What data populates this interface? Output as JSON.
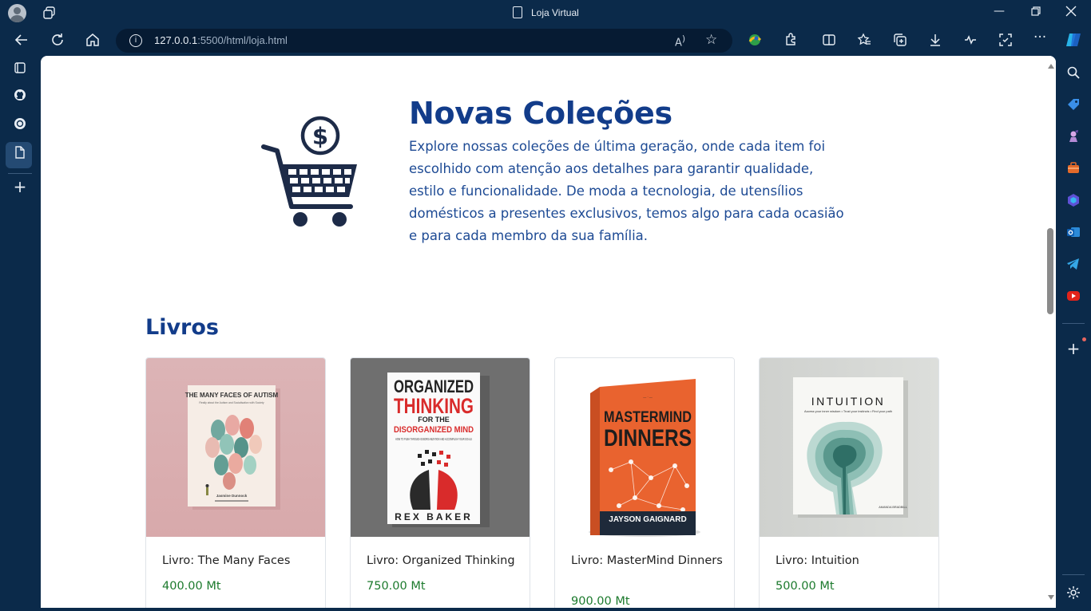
{
  "window": {
    "title": "Loja Virtual"
  },
  "address_bar": {
    "url_host": "127.0.0.1",
    "url_rest": ":5500/html/loja.html"
  },
  "hero": {
    "title": "Novas Coleções",
    "description": "Explore nossas coleções de última geração, onde cada item foi escolhido com atenção aos detalhes para garantir qualidade, estilo e funcionalidade. De moda a tecnologia, de utensílios domésticos a presentes exclusivos, temos algo para cada ocasião e para cada membro da sua família."
  },
  "section": {
    "title": "Livros"
  },
  "products": [
    {
      "name": "Livro: The Many Faces",
      "price": "400.00 Mt",
      "cover_title": "THE MANY FACES OF AUTISM",
      "cover_subtitle": "Really about the Autism and Socialisation with Society",
      "cover_author": "Jasmine Dunnock",
      "bg": "#d9aeb0"
    },
    {
      "name": "Livro: Organized Thinking",
      "price": "750.00 Mt",
      "cover_title_1": "ORGANIZED",
      "cover_title_2": "THINKING",
      "cover_title_3": "FOR THE",
      "cover_title_4": "DISORGANIZED MIND",
      "cover_subtitle": "HOW TO PUSH THROUGH DISORGANIZATION AND ACCOMPLISH YOUR GOALS",
      "cover_author": "REX BAKER",
      "bg": "#6f6f6f"
    },
    {
      "name": "Livro: MasterMind Dinners",
      "price": "900.00 Mt",
      "cover_title_1": "MASTERMIND",
      "cover_title_2": "DINNERS",
      "cover_author": "JAYSON GAIGNARD",
      "bg": "#ffffff"
    },
    {
      "name": "Livro: Intuition",
      "price": "500.00 Mt",
      "cover_title": "INTUITION",
      "cover_subtitle": "Access your inner wisdom • Trust your instincts • Find your path",
      "cover_author": "AMANDA BRADBILL",
      "bg": "#d4d6d3"
    }
  ]
}
